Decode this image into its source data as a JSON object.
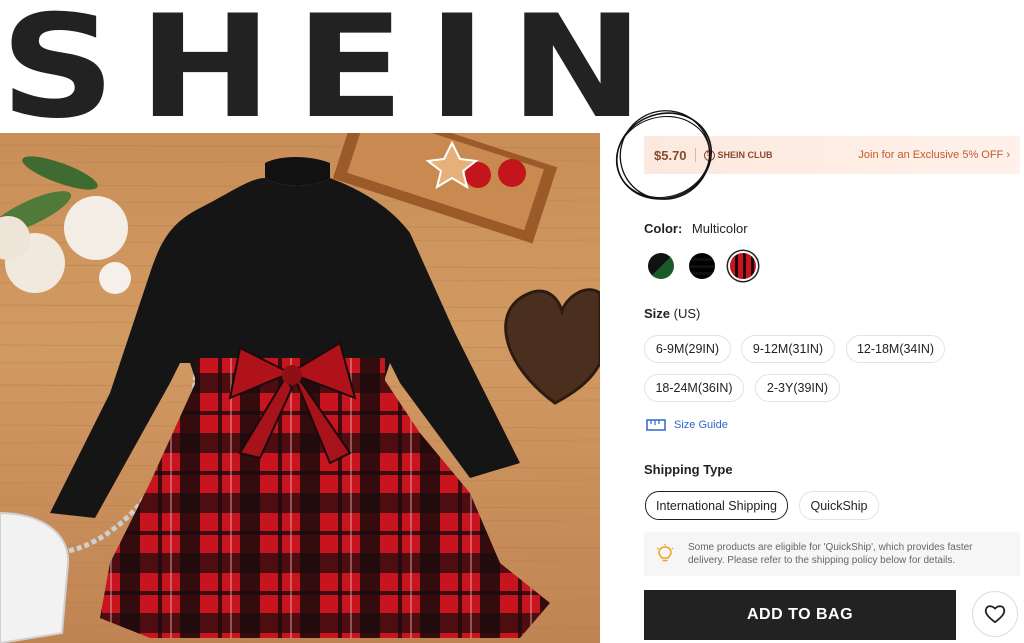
{
  "brand": {
    "logo_text": "SHEIN"
  },
  "club": {
    "price": "$5.70",
    "club_name": "SHEIN CLUB",
    "join_text": "Join for an Exclusive 5% OFF ›"
  },
  "color": {
    "label": "Color:",
    "value": "Multicolor",
    "swatches": [
      {
        "icon": "green-black-swatch",
        "selected": false
      },
      {
        "icon": "black-white-plaid-swatch",
        "selected": false
      },
      {
        "icon": "red-black-plaid-swatch",
        "selected": true
      }
    ]
  },
  "size": {
    "label": "Size",
    "unit": "(US)",
    "options": [
      "6-9M(29IN)",
      "9-12M(31IN)",
      "12-18M(34IN)",
      "18-24M(36IN)",
      "2-3Y(39IN)"
    ],
    "guide_label": "Size Guide"
  },
  "shipping": {
    "label": "Shipping Type",
    "options": [
      "International Shipping",
      "QuickShip"
    ],
    "selected": "International Shipping",
    "notice": "Some products are eligible for 'QuickShip', which provides faster delivery. Please refer to the shipping policy below for details."
  },
  "actions": {
    "add_to_bag": "ADD TO BAG",
    "wishlist_icon": "heart-icon"
  },
  "colors": {
    "primary": "#222222",
    "club_accent": "#8a4a2b",
    "link": "#2d68c8",
    "notice_icon": "#f0a020"
  }
}
